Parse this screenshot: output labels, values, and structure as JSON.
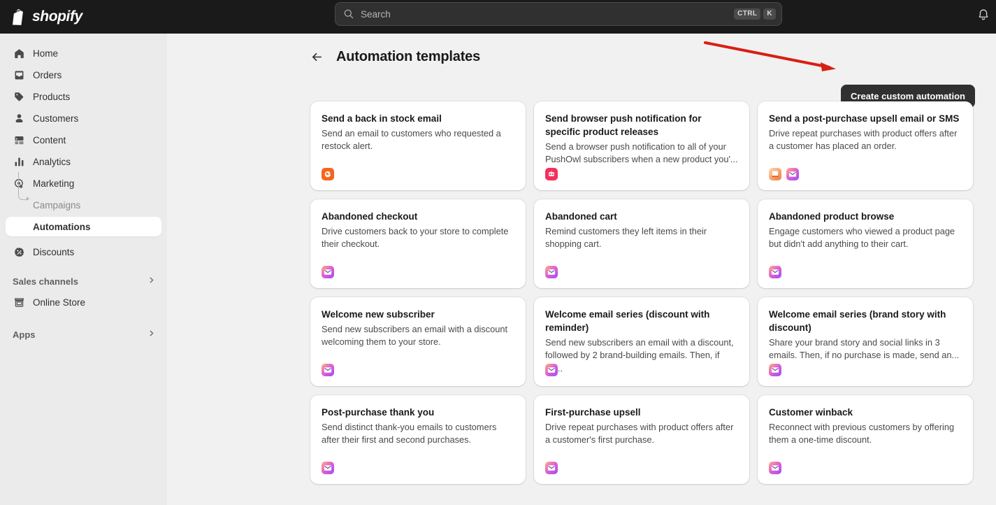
{
  "topbar": {
    "brand_name": "shopify",
    "brand_logo_icon": "shopify-bag-logo",
    "search": {
      "placeholder": "Search",
      "value": "",
      "icon": "search-icon",
      "shortcut_keys": [
        "CTRL",
        "K"
      ]
    },
    "notifications_icon": "bell-icon"
  },
  "sidebar": {
    "items": [
      {
        "label": "Home",
        "icon": "home-icon"
      },
      {
        "label": "Orders",
        "icon": "orders-inbox-icon"
      },
      {
        "label": "Products",
        "icon": "tag-icon"
      },
      {
        "label": "Customers",
        "icon": "person-icon"
      },
      {
        "label": "Content",
        "icon": "image-icon"
      },
      {
        "label": "Analytics",
        "icon": "bar-chart-icon"
      },
      {
        "label": "Marketing",
        "icon": "marketing-target-icon"
      }
    ],
    "marketing_children": [
      {
        "label": "Campaigns",
        "selected": false
      },
      {
        "label": "Automations",
        "selected": true
      }
    ],
    "discounts": {
      "label": "Discounts",
      "icon": "discount-icon"
    },
    "sales_channels": {
      "label": "Sales channels",
      "chevron_icon": "chevron-right-icon",
      "children": [
        {
          "label": "Online Store",
          "icon": "storefront-icon"
        }
      ]
    },
    "apps": {
      "label": "Apps",
      "chevron_icon": "chevron-right-icon"
    }
  },
  "main": {
    "back_icon": "arrow-left-icon",
    "title": "Automation templates",
    "create_button_label": "Create custom automation",
    "annotation": {
      "type": "red-arrow",
      "color": "#d81f13",
      "points_to": "create-custom-automation-button"
    },
    "templates": [
      {
        "title": "Send a back in stock email",
        "description": "Send an email to customers who requested a restock alert.",
        "icons": [
          "back-in-stock-app-icon"
        ]
      },
      {
        "title": "Send browser push notification for specific product releases",
        "description": "Send a browser push notification to all of your PushOwl subscribers when a new product you'...",
        "icons": [
          "pushowl-app-icon"
        ]
      },
      {
        "title": "Send a post-purchase upsell email or SMS",
        "description": "Drive repeat purchases with product offers after a customer has placed an order.",
        "icons": [
          "sms-icon",
          "email-icon"
        ]
      },
      {
        "title": "Abandoned checkout",
        "description": "Drive customers back to your store to complete their checkout.",
        "icons": [
          "email-icon"
        ]
      },
      {
        "title": "Abandoned cart",
        "description": "Remind customers they left items in their shopping cart.",
        "icons": [
          "email-icon"
        ]
      },
      {
        "title": "Abandoned product browse",
        "description": "Engage customers who viewed a product page but didn't add anything to their cart.",
        "icons": [
          "email-icon"
        ]
      },
      {
        "title": "Welcome new subscriber",
        "description": "Send new subscribers an email with a discount welcoming them to your store.",
        "icons": [
          "email-icon"
        ]
      },
      {
        "title": "Welcome email series (discount with reminder)",
        "description": "Send new subscribers an email with a discount, followed by 2 brand-building emails. Then, if no...",
        "icons": [
          "email-icon"
        ]
      },
      {
        "title": "Welcome email series (brand story with discount)",
        "description": "Share your brand story and social links in 3 emails. Then, if no purchase is made, send an...",
        "icons": [
          "email-icon"
        ]
      },
      {
        "title": "Post-purchase thank you",
        "description": "Send distinct thank-you emails to customers after their first and second purchases.",
        "icons": [
          "email-icon"
        ]
      },
      {
        "title": "First-purchase upsell",
        "description": "Drive repeat purchases with product offers after a customer's first purchase.",
        "icons": [
          "email-icon"
        ]
      },
      {
        "title": "Customer winback",
        "description": "Reconnect with previous customers by offering them a one-time discount.",
        "icons": [
          "email-icon"
        ]
      }
    ]
  },
  "colors": {
    "topbar_bg": "#1a1a1a",
    "sidebar_bg": "#ebebeb",
    "page_bg": "#f1f1f1",
    "card_bg": "#ffffff",
    "primary_button_bg": "#303030",
    "annotation_red": "#d81f13"
  }
}
